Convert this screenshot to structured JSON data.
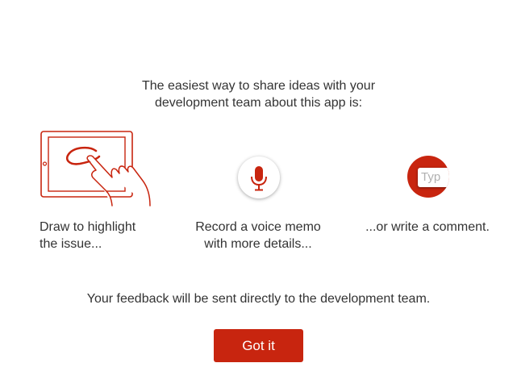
{
  "intro": {
    "line1": "The easiest way to share ideas with your",
    "line2": "development team about this app is:"
  },
  "features": [
    {
      "icon": "tablet-hand-draw-icon",
      "label_line1": "Draw to highlight",
      "label_line2": "the issue..."
    },
    {
      "icon": "microphone-icon",
      "label_line1": "Record a voice memo",
      "label_line2": "with more details..."
    },
    {
      "icon": "text-input-icon",
      "icon_text": "Typ",
      "label_line1": "...or write a comment."
    }
  ],
  "note": "Your feedback will be sent directly to the development team.",
  "button": {
    "label": "Got it"
  },
  "colors": {
    "accent": "#c8250f",
    "text": "#333333",
    "background": "#ffffff"
  }
}
